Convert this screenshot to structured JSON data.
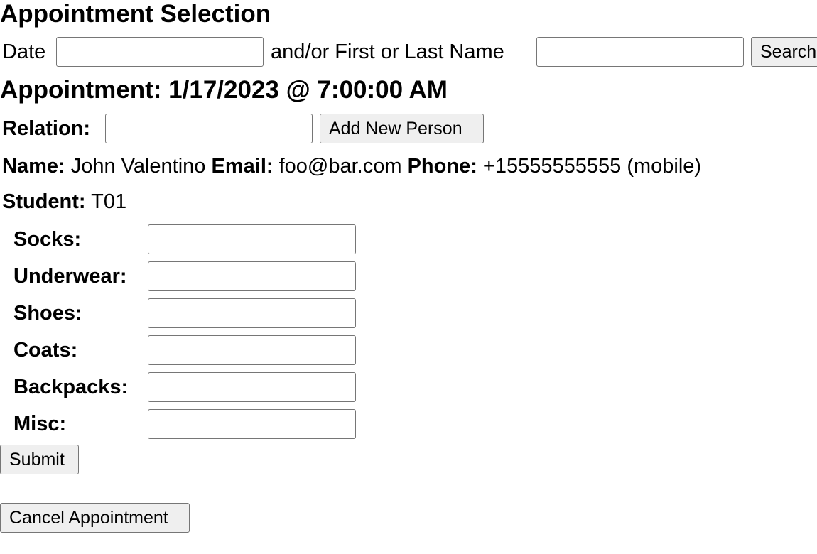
{
  "header": {
    "title": "Appointment Selection"
  },
  "search": {
    "date_label": "Date",
    "date_value": "",
    "name_label": "and/or First or Last Name",
    "name_value": "",
    "search_button": "Search"
  },
  "appointment": {
    "heading": "Appointment: 1/17/2023 @ 7:00:00 AM",
    "relation_label": "Relation:",
    "relation_value": "",
    "add_person_button": "Add New Person"
  },
  "person": {
    "name_label": "Name:",
    "name_value": "John Valentino",
    "email_label": "Email:",
    "email_value": "foo@bar.com",
    "phone_label": "Phone:",
    "phone_value": "+15555555555 (mobile)",
    "student_label": "Student:",
    "student_value": "T01"
  },
  "items": [
    {
      "label": "Socks:",
      "value": ""
    },
    {
      "label": "Underwear:",
      "value": ""
    },
    {
      "label": "Shoes:",
      "value": ""
    },
    {
      "label": "Coats:",
      "value": ""
    },
    {
      "label": "Backpacks:",
      "value": ""
    },
    {
      "label": "Misc:",
      "value": ""
    }
  ],
  "actions": {
    "submit_button": "Submit",
    "cancel_button": "Cancel Appointment"
  }
}
